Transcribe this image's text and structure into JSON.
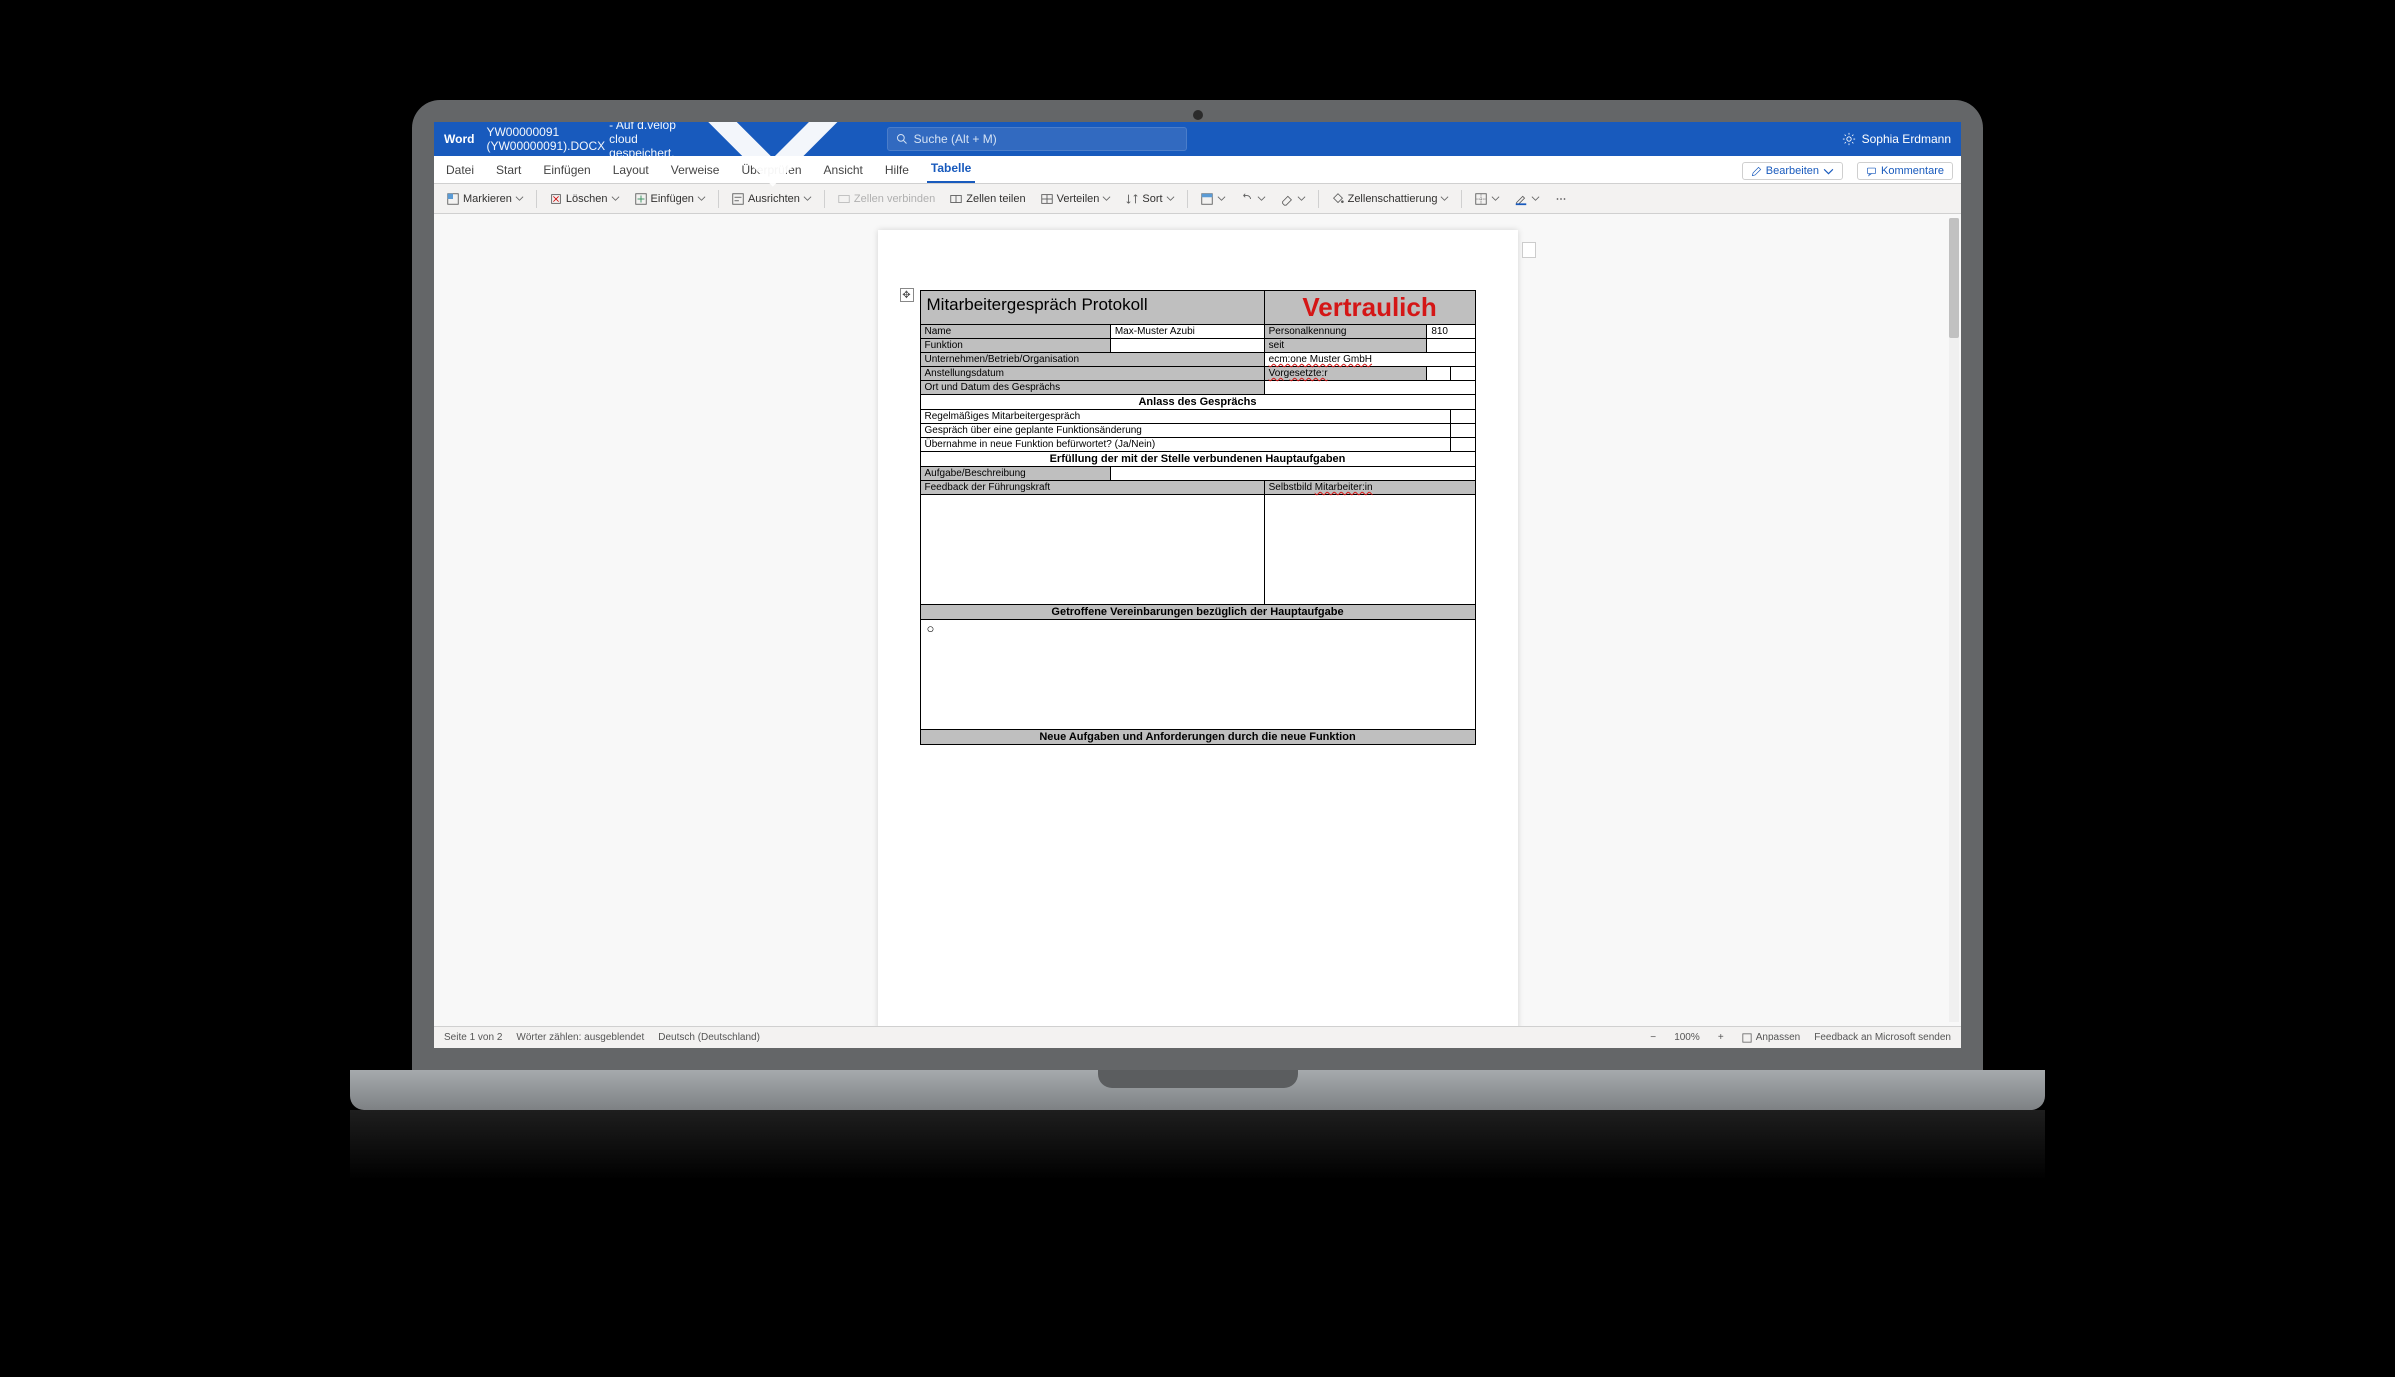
{
  "titlebar": {
    "app": "Word",
    "doc_name": "YW00000091 (YW00000091).DOCX",
    "doc_status": " - Auf d.velop cloud gespeichert.",
    "search_placeholder": "Suche (Alt + M)",
    "user": "Sophia Erdmann"
  },
  "tabs": {
    "items": [
      "Datei",
      "Start",
      "Einfügen",
      "Layout",
      "Verweise",
      "Überprüfen",
      "Ansicht",
      "Hilfe",
      "Tabelle"
    ],
    "active": "Tabelle",
    "edit": "Bearbeiten",
    "comments": "Kommentare"
  },
  "ribbon": {
    "markieren": "Markieren",
    "loeschen": "Löschen",
    "einfuegen": "Einfügen",
    "ausrichten": "Ausrichten",
    "zellen_verbinden": "Zellen verbinden",
    "zellen_teilen": "Zellen teilen",
    "verteilen": "Verteilen",
    "sort": "Sort",
    "zellenschattierung": "Zellenschattierung"
  },
  "doc": {
    "title": "Mitarbeitergespräch Protokoll",
    "confidential": "Vertraulich",
    "fields": {
      "name_label": "Name",
      "name_value": "Max-Muster Azubi",
      "personalnr_label": "Personalkennung",
      "personalnr_value": "810",
      "funktion_label": "Funktion",
      "seit_label": "seit",
      "org_label": "Unternehmen/Betrieb/Organisation",
      "org_value": "ecm:one Muster GmbH",
      "anstellung_label": "Anstellungsdatum",
      "vorgesetzter_label": "Vorgesetzte:r",
      "ortdatum_label": "Ort und Datum des Gesprächs"
    },
    "sections": {
      "anlass": "Anlass des Gesprächs",
      "anlass_rows": [
        "Regelmäßiges Mitarbeitergespräch",
        "Gespräch über eine geplante Funktionsänderung",
        "Übernahme in neue Funktion befürwortet? (Ja/Nein)"
      ],
      "erfuellung": "Erfüllung der mit der Stelle verbundenen Hauptaufgaben",
      "aufgabe_label": "Aufgabe/Beschreibung",
      "feedback_label": "Feedback der Führungskraft",
      "selbstbild_label": "Selbstbild Mitarbeiter:in",
      "vereinbarungen": "Getroffene Vereinbarungen bezüglich der Hauptaufgabe",
      "neue_aufgaben": "Neue Aufgaben und Anforderungen durch die neue Funktion"
    }
  },
  "status": {
    "page": "Seite 1 von 2",
    "words": "Wörter zählen: ausgeblendet",
    "lang": "Deutsch (Deutschland)",
    "zoom": "100%",
    "fit": "Anpassen",
    "feedback": "Feedback an Microsoft senden"
  }
}
